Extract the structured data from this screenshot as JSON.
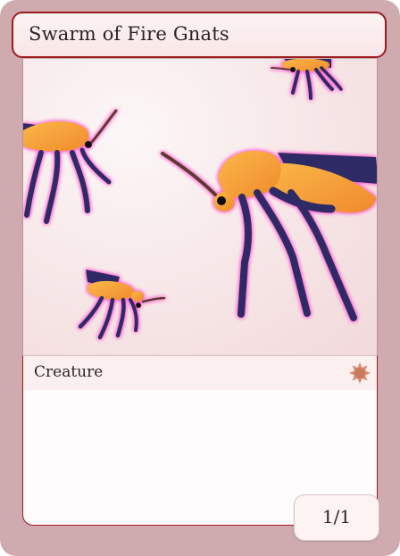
{
  "card": {
    "name": "Swarm of Fire Gnats",
    "type_line": "Creature",
    "power_toughness": "1/1",
    "rules_text": "",
    "set_symbol": "sun-starburst-icon",
    "colors": {
      "frame": "#cfaaaf",
      "border_accent": "#9b1c1c",
      "gnat_body": "#f6a33a",
      "gnat_legs": "#2e2a66",
      "glow": "#ff4fd0",
      "set_symbol": "#d98c6e"
    }
  }
}
